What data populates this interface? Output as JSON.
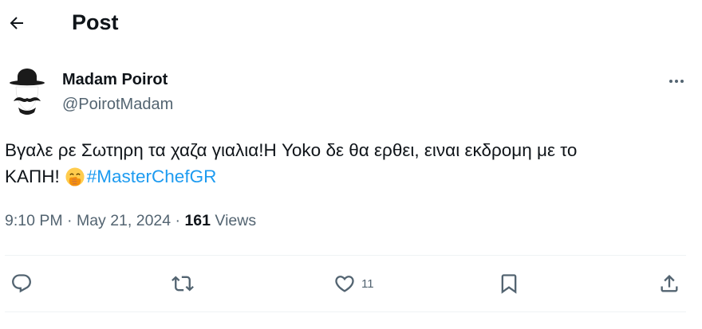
{
  "header": {
    "title": "Post",
    "back_icon": "arrow-left-icon"
  },
  "author": {
    "name": "Madam Poirot",
    "handle": "@PoirotMadam",
    "avatar_icon": "bowler-hat-mustache-avatar"
  },
  "more_icon": "more-horizontal-icon",
  "tweet": {
    "line1": "Βγαλε ρε Σωτηρη τα χαζα γιαλια!Η Yoko δε θα ερθει, ειναι εκδρομη με το",
    "line2": "ΚΑΠΗ!",
    "emoji_icon": "face-with-hand-over-mouth-emoji",
    "hashtag": "#MasterChefGR"
  },
  "meta": {
    "time_date": "9:10 PM · May 21, 2024 · ",
    "views_count": "161",
    "views_label": " Views"
  },
  "actions": {
    "reply_icon": "reply-icon",
    "retweet_icon": "retweet-icon",
    "like_icon": "heart-icon",
    "like_count": "11",
    "bookmark_icon": "bookmark-icon",
    "share_icon": "share-icon"
  },
  "colors": {
    "text_primary": "#0f1419",
    "text_secondary": "#536471",
    "link": "#1d9bf0",
    "divider": "#eff3f4"
  }
}
